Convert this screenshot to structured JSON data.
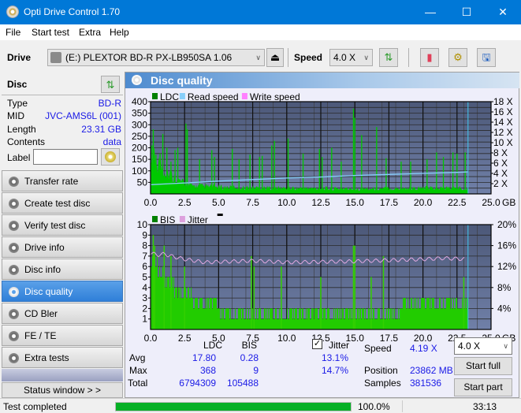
{
  "window": {
    "title": "Opti Drive Control 1.70",
    "minimize": "—",
    "maximize": "☐",
    "close": "✕"
  },
  "menu": [
    "File",
    "Start test",
    "Extra",
    "Help"
  ],
  "toolbar": {
    "drive_label": "Drive",
    "drive_value": "(E:)  PLEXTOR BD-R  PX-LB950SA 1.06",
    "speed_label": "Speed",
    "speed_value": "4.0 X",
    "icons": [
      "eject-icon",
      "refresh-icon",
      "eraser-icon",
      "settings-icon",
      "save-icon"
    ]
  },
  "disc": {
    "header": "Disc",
    "rows": [
      {
        "key": "Type",
        "value": "BD-R"
      },
      {
        "key": "MID",
        "value": "JVC-AMS6L (001)"
      },
      {
        "key": "Length",
        "value": "23.31 GB"
      },
      {
        "key": "Contents",
        "value": "data"
      }
    ],
    "label_key": "Label",
    "label_value": ""
  },
  "nav": [
    {
      "label": "Transfer rate",
      "active": false
    },
    {
      "label": "Create test disc",
      "active": false
    },
    {
      "label": "Verify test disc",
      "active": false
    },
    {
      "label": "Drive info",
      "active": false
    },
    {
      "label": "Disc info",
      "active": false
    },
    {
      "label": "Disc quality",
      "active": true
    },
    {
      "label": "CD Bler",
      "active": false
    },
    {
      "label": "FE / TE",
      "active": false
    },
    {
      "label": "Extra tests",
      "active": false
    }
  ],
  "status_window_btn": "Status window > >",
  "panel_title": "Disc quality",
  "chart_data": [
    {
      "type": "bar",
      "title": "LDC / Read speed",
      "legend": [
        {
          "name": "LDC",
          "color": "#008000"
        },
        {
          "name": "Read speed",
          "color": "#87cefa"
        },
        {
          "name": "Write speed",
          "color": "#ff80ff"
        }
      ],
      "xlabel": "GB",
      "x_ticks": [
        "0.0",
        "2.5",
        "5.0",
        "7.5",
        "10.0",
        "12.5",
        "15.0",
        "17.5",
        "20.0",
        "22.5",
        "25.0"
      ],
      "xlim": [
        0,
        25
      ],
      "y_ticks": [
        50,
        100,
        150,
        200,
        250,
        300,
        350,
        400
      ],
      "ylim": [
        0,
        400
      ],
      "y2_ticks": [
        "2 X",
        "4 X",
        "6 X",
        "8 X",
        "10 X",
        "12 X",
        "14 X",
        "16 X",
        "18 X"
      ],
      "y2lim": [
        0,
        18
      ],
      "position_marker_gb": 23.31,
      "ldc_spikes": [
        [
          0.1,
          210
        ],
        [
          0.2,
          280
        ],
        [
          0.4,
          170
        ],
        [
          0.7,
          175
        ],
        [
          0.9,
          260
        ],
        [
          1.2,
          200
        ],
        [
          1.5,
          140
        ],
        [
          1.8,
          190
        ],
        [
          2.0,
          200
        ],
        [
          2.6,
          305
        ],
        [
          2.7,
          280
        ],
        [
          3.6,
          150
        ],
        [
          4.5,
          190
        ],
        [
          4.7,
          160
        ],
        [
          6.0,
          195
        ],
        [
          6.5,
          150
        ],
        [
          7.3,
          170
        ],
        [
          8.0,
          160
        ],
        [
          8.2,
          165
        ],
        [
          8.9,
          210
        ],
        [
          9.1,
          230
        ],
        [
          10.1,
          240
        ],
        [
          11.2,
          175
        ],
        [
          12.4,
          195
        ],
        [
          12.6,
          160
        ],
        [
          13.3,
          200
        ],
        [
          14.0,
          140
        ],
        [
          14.9,
          370
        ],
        [
          15.0,
          330
        ],
        [
          15.5,
          255
        ],
        [
          16.6,
          290
        ],
        [
          17.3,
          155
        ],
        [
          18.4,
          140
        ],
        [
          19.1,
          140
        ],
        [
          20.3,
          150
        ],
        [
          21.0,
          180
        ],
        [
          21.5,
          160
        ],
        [
          22.2,
          180
        ],
        [
          22.5,
          175
        ],
        [
          23.1,
          180
        ]
      ],
      "ldc_baseline": [
        [
          0,
          150
        ],
        [
          0.5,
          140
        ],
        [
          1,
          110
        ],
        [
          1.5,
          80
        ],
        [
          2,
          60
        ],
        [
          2.5,
          45
        ],
        [
          3,
          35
        ],
        [
          5,
          30
        ],
        [
          10,
          25
        ],
        [
          15,
          22
        ],
        [
          20,
          25
        ],
        [
          23.3,
          25
        ]
      ],
      "read_speed": [
        [
          0,
          1.8
        ],
        [
          1.5,
          2.0
        ],
        [
          3,
          2.2
        ],
        [
          5,
          2.5
        ],
        [
          7.5,
          2.8
        ],
        [
          10,
          3.1
        ],
        [
          12.5,
          3.3
        ],
        [
          15,
          3.6
        ],
        [
          17.5,
          3.8
        ],
        [
          20,
          4.0
        ],
        [
          22.5,
          4.2
        ],
        [
          23.31,
          4.3
        ]
      ]
    },
    {
      "type": "bar",
      "title": "BIS / Jitter",
      "legend": [
        {
          "name": "BIS",
          "color": "#008000"
        },
        {
          "name": "Jitter",
          "color": "#dda0dd"
        }
      ],
      "xlabel": "GB",
      "x_ticks": [
        "0.0",
        "2.5",
        "5.0",
        "7.5",
        "10.0",
        "12.5",
        "15.0",
        "17.5",
        "20.0",
        "22.5",
        "25.0"
      ],
      "xlim": [
        0,
        25
      ],
      "y_ticks": [
        1,
        2,
        3,
        4,
        5,
        6,
        7,
        8,
        9,
        10
      ],
      "ylim": [
        0,
        10
      ],
      "y2_ticks": [
        "4%",
        "8%",
        "12%",
        "16%",
        "20%"
      ],
      "y2lim": [
        0,
        20
      ],
      "position_marker_gb": 23.31,
      "bis_levels": [
        [
          0,
          7
        ],
        [
          0.5,
          6
        ],
        [
          1,
          5
        ],
        [
          1.7,
          4
        ],
        [
          3,
          3
        ],
        [
          5,
          2
        ],
        [
          12,
          2
        ],
        [
          18.5,
          3
        ],
        [
          23.31,
          3
        ]
      ],
      "bis_spikes": [
        [
          0.2,
          9
        ],
        [
          0.3,
          8
        ],
        [
          1.0,
          8
        ],
        [
          1.5,
          7
        ],
        [
          2.5,
          6
        ],
        [
          7.4,
          7
        ],
        [
          7.6,
          6
        ],
        [
          9.6,
          6
        ],
        [
          12.5,
          5
        ],
        [
          14.9,
          8
        ],
        [
          15.0,
          8
        ],
        [
          16.2,
          5
        ],
        [
          17.1,
          7
        ],
        [
          23.0,
          5
        ]
      ],
      "jitter": [
        [
          0,
          14.6
        ],
        [
          0.5,
          14.2
        ],
        [
          1,
          14.4
        ],
        [
          1.5,
          14.0
        ],
        [
          2.5,
          13.4
        ],
        [
          4,
          12.8
        ],
        [
          5,
          12.9
        ],
        [
          7.5,
          13.1
        ],
        [
          10,
          12.8
        ],
        [
          12.5,
          12.9
        ],
        [
          15,
          13.0
        ],
        [
          17.5,
          13.2
        ],
        [
          20,
          13.4
        ],
        [
          21.5,
          13.6
        ],
        [
          23.31,
          13.4
        ]
      ]
    }
  ],
  "stats": {
    "col_ldc": "LDC",
    "col_bis": "BIS",
    "jitter_label": "Jitter",
    "jitter_checked": true,
    "rows": [
      {
        "label": "Avg",
        "ldc": "17.80",
        "bis": "0.28",
        "jitter": "13.1%"
      },
      {
        "label": "Max",
        "ldc": "368",
        "bis": "9",
        "jitter": "14.7%"
      },
      {
        "label": "Total",
        "ldc": "6794309",
        "bis": "105488",
        "jitter": ""
      }
    ],
    "speed_label": "Speed",
    "speed_value": "4.19 X",
    "position_label": "Position",
    "position_value": "23862 MB",
    "samples_label": "Samples",
    "samples_value": "381536",
    "speed_select": "4.0 X",
    "start_full": "Start full",
    "start_part": "Start part"
  },
  "statusbar": {
    "text": "Test completed",
    "progress_pct": 100,
    "progress_text": "100.0%",
    "time": "33:13"
  }
}
